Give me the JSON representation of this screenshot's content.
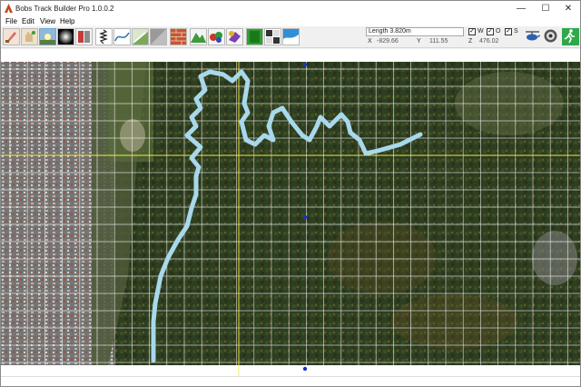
{
  "window": {
    "title": "Bobs Track Builder Pro 1.0.0.2",
    "minimize_glyph": "—",
    "maximize_glyph": "☐",
    "close_glyph": "✕"
  },
  "menu": {
    "items": [
      "File",
      "Edit",
      "View",
      "Help"
    ]
  },
  "toolbar": {
    "tools": [
      "paint-brush-icon",
      "hand-paint-icon",
      "sun-icon",
      "gradient-icon",
      "ruler-icon",
      "spring-icon",
      "line-draw-icon",
      "terrain-icon",
      "texture-icon",
      "brick-wall-icon",
      "mountains-icon",
      "trees-icon",
      "eraser-icon",
      "checker-flag-icon",
      "camera-icon",
      "water-icon"
    ],
    "active_tool": "sun-icon"
  },
  "info": {
    "length_text": "Length 3.820m",
    "x_label": "X",
    "x_value": "-829.66",
    "y_label": "Y",
    "y_value": "111.55",
    "z_label": "Z",
    "z_value": "476.02",
    "checkboxes": [
      {
        "label": "W",
        "checked": true
      },
      {
        "label": "O",
        "checked": true
      },
      {
        "label": "S",
        "checked": true
      }
    ]
  },
  "right_tools": [
    "helicopter-icon",
    "steering-wheel-icon",
    "run-icon"
  ],
  "colors": {
    "track": "#a9d8ec",
    "grid": "#ffffff",
    "grid_accent": "#f2ef3a",
    "forest": "#2f3f1f",
    "town": "#6f6f6f",
    "marker": "#1a33c8"
  }
}
